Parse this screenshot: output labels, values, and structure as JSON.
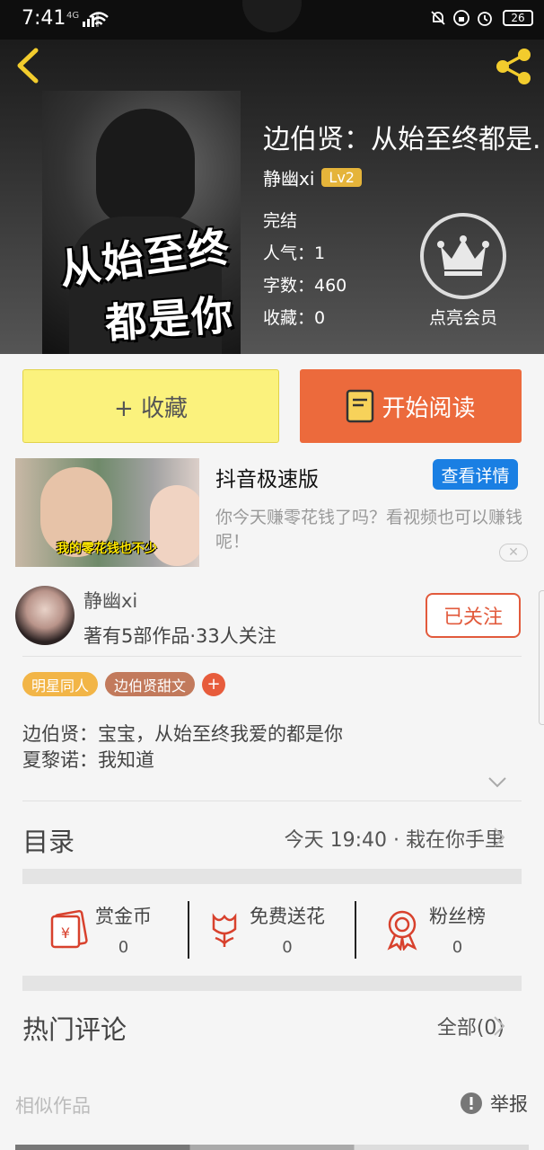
{
  "status_bar": {
    "time": "7:41",
    "network": "4G",
    "battery": "26"
  },
  "book": {
    "title": "边伯贤：从始至终都是...",
    "cover_text": [
      "从始至终",
      "都是你"
    ],
    "author": "静幽xi",
    "level": "Lv2",
    "status": "完结",
    "popularity": "人气：1",
    "word_count": "字数：460",
    "favorites": "收藏：0",
    "vip_label": "点亮会员"
  },
  "buttons": {
    "collect": "+ 收藏",
    "read": "开始阅读"
  },
  "ad": {
    "title": "抖音极速版",
    "detail_button": "查看详情",
    "description": "你今天赚零花钱了吗？看视频也可以赚钱呢！",
    "thumb_caption": "我的零花钱也不少",
    "close": "✕"
  },
  "author_card": {
    "name": "静幽xi",
    "stats": "著有5部作品·33人关注",
    "follow_button": "已关注"
  },
  "tags": [
    "明星同人",
    "边伯贤甜文"
  ],
  "tag_add": "+",
  "intro": [
    "边伯贤：宝宝，从始至终我爱的都是你",
    "夏黎诺：我知道"
  ],
  "toc": {
    "title": "目录",
    "latest": "今天 19:40 · 栽在你手里"
  },
  "actions": [
    {
      "label": "赏金币",
      "count": "0"
    },
    {
      "label": "免费送花",
      "count": "0"
    },
    {
      "label": "粉丝榜",
      "count": "0"
    }
  ],
  "comments": {
    "title": "热门评论",
    "all": "全部(0)"
  },
  "similar": {
    "title": "相似作品",
    "report": "举报"
  },
  "colors": {
    "accent": "#ec6a3c",
    "collect_bg": "#fbf27d",
    "link_blue": "#1a7fe3",
    "follow_red": "#e25a3c"
  }
}
